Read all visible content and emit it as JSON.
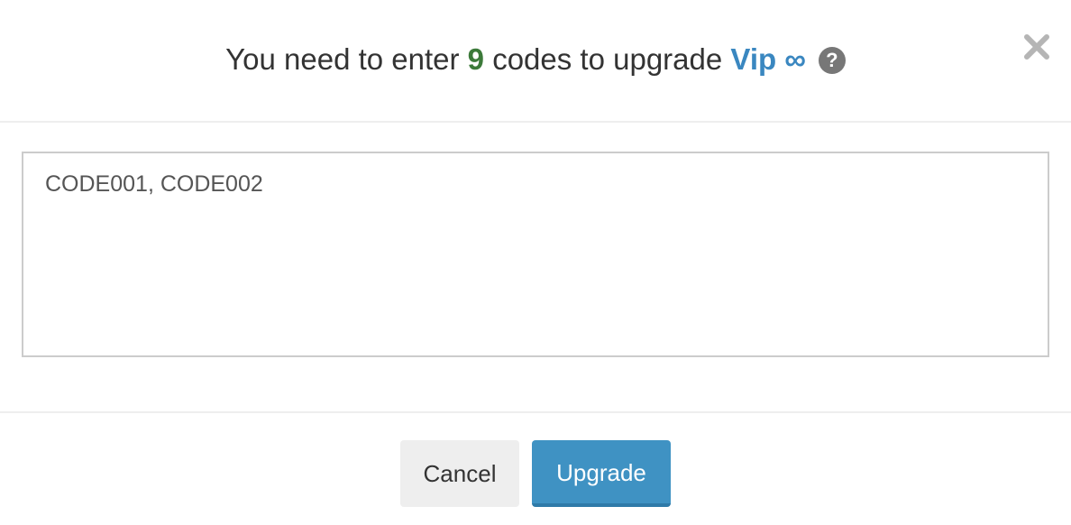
{
  "dialog": {
    "title_prefix": "You need to enter",
    "code_count": "9",
    "title_middle": "codes to upgrade",
    "plan_name": "Vip ∞",
    "help_glyph": "?",
    "close_icon": "close-icon"
  },
  "codes_input": {
    "value": "CODE001, CODE002"
  },
  "footer": {
    "cancel_label": "Cancel",
    "upgrade_label": "Upgrade"
  },
  "colors": {
    "count": "#3c7a3a",
    "plan": "#3a87c0",
    "primary_button": "#3f92c3",
    "secondary_button": "#eeeeee"
  }
}
